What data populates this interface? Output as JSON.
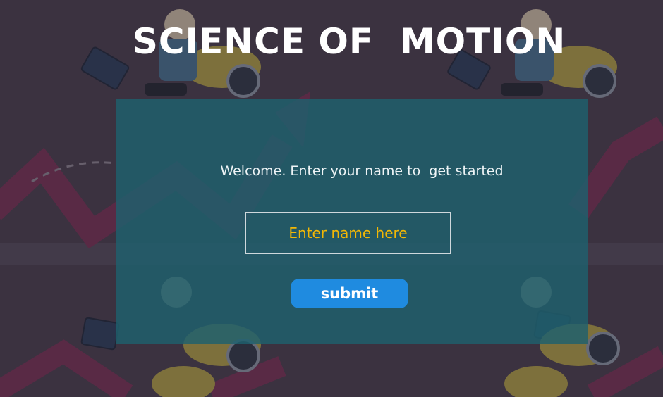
{
  "app": {
    "title": "SCIENCE OF  MOTION"
  },
  "form": {
    "welcome_text": "Welcome. Enter your name to  get started",
    "name_placeholder": "Enter name here",
    "submit_label": "submit"
  },
  "colors": {
    "background": "#3c3340",
    "panel": "#1e606e",
    "accent_button": "#1f8be0",
    "placeholder_text": "#f2b705",
    "arrow": "#7a2a4a"
  },
  "icons": {
    "background_illustration": "scooter-rider-briefcase-growth-arrow-pattern"
  }
}
